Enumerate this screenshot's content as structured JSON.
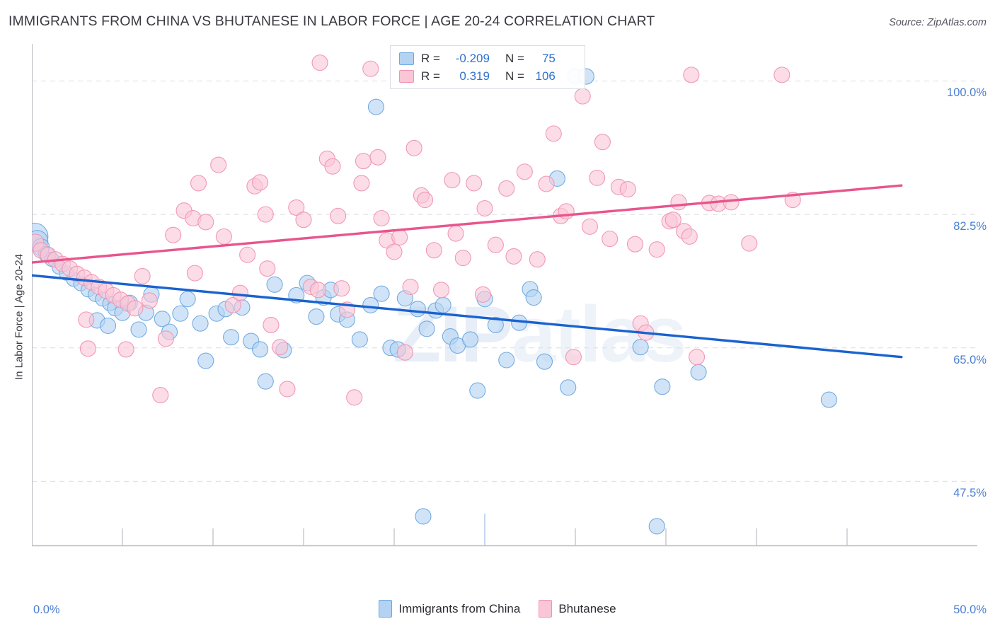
{
  "header": {
    "title": "IMMIGRANTS FROM CHINA VS BHUTANESE IN LABOR FORCE | AGE 20-24 CORRELATION CHART",
    "source": "Source: ZipAtlas.com"
  },
  "watermark": {
    "text_1": "ZIP",
    "text_2": "atlas"
  },
  "stats": {
    "rows": [
      {
        "series": "Immigrants from China",
        "swatch": "blue",
        "r_key": "R =",
        "r_value": "-0.209",
        "n_key": "N =",
        "n_value": "75"
      },
      {
        "series": "Bhutanese",
        "swatch": "pink",
        "r_key": "R =",
        "r_value": "0.319",
        "n_key": "N =",
        "n_value": "106"
      }
    ]
  },
  "legend": {
    "items": [
      {
        "label": "Immigrants from China",
        "color": "#b4d3f2"
      },
      {
        "label": "Bhutanese",
        "color": "#fac6d6"
      }
    ]
  },
  "colors": {
    "blue_fill": "#b4d3f2",
    "blue_stroke": "#6ea8e0",
    "blue_line": "#1a62cf",
    "pink_fill": "#fac6d6",
    "pink_stroke": "#f093b2",
    "pink_line": "#e8558c",
    "tick_text": "#4a7fd4",
    "grid": "#dcdce2"
  },
  "chart_data": {
    "type": "scatter",
    "title": "IMMIGRANTS FROM CHINA VS BHUTANESE IN LABOR FORCE | AGE 20-24 CORRELATION CHART",
    "xlabel": "",
    "ylabel": "In Labor Force | Age 20-24",
    "xlim": [
      0,
      50
    ],
    "ylim": [
      39.0,
      103.2
    ],
    "grid": true,
    "legend_position": "bottom-center",
    "x_ticks": [
      {
        "value": 0,
        "label": "0.0%"
      },
      {
        "value": 50,
        "label": "50.0%"
      }
    ],
    "y_ticks": [
      {
        "value": 100.0,
        "label": "100.0%"
      },
      {
        "value": 82.5,
        "label": "82.5%"
      },
      {
        "value": 65.0,
        "label": "65.0%"
      },
      {
        "value": 47.5,
        "label": "47.5%"
      }
    ],
    "series": [
      {
        "name": "Immigrants from China",
        "color": "#b4d3f2",
        "stroke": "#6ea8e0",
        "r": -0.209,
        "n": 75,
        "trendline": {
          "color": "#1a62cf",
          "x0": 0.0,
          "y0": 74.5,
          "x1": 48.0,
          "y1": 63.8
        },
        "points": [
          {
            "x": 0.15,
            "y": 79.6,
            "r": 19
          },
          {
            "x": 0.3,
            "y": 79.0,
            "r": 15
          },
          {
            "x": 0.5,
            "y": 78.2,
            "r": 12
          },
          {
            "x": 0.8,
            "y": 77.3,
            "r": 11
          },
          {
            "x": 1.1,
            "y": 76.6,
            "r": 10
          },
          {
            "x": 1.5,
            "y": 75.6,
            "r": 10
          },
          {
            "x": 1.9,
            "y": 74.8,
            "r": 10
          },
          {
            "x": 2.3,
            "y": 74.0,
            "r": 10
          },
          {
            "x": 2.7,
            "y": 73.4,
            "r": 10
          },
          {
            "x": 3.1,
            "y": 72.6,
            "r": 10
          },
          {
            "x": 3.5,
            "y": 72.0,
            "r": 10
          },
          {
            "x": 3.9,
            "y": 71.4,
            "r": 10
          },
          {
            "x": 4.3,
            "y": 70.8,
            "r": 10
          },
          {
            "x": 4.6,
            "y": 70.2,
            "r": 11
          },
          {
            "x": 5.0,
            "y": 69.6,
            "r": 11
          },
          {
            "x": 3.6,
            "y": 68.6,
            "r": 11
          },
          {
            "x": 4.2,
            "y": 67.9,
            "r": 11
          },
          {
            "x": 5.4,
            "y": 70.9,
            "r": 11
          },
          {
            "x": 5.9,
            "y": 67.4,
            "r": 11
          },
          {
            "x": 6.3,
            "y": 69.6,
            "r": 11
          },
          {
            "x": 6.6,
            "y": 72.0,
            "r": 11
          },
          {
            "x": 7.2,
            "y": 68.8,
            "r": 11
          },
          {
            "x": 7.6,
            "y": 67.1,
            "r": 11
          },
          {
            "x": 8.2,
            "y": 69.5,
            "r": 11
          },
          {
            "x": 8.6,
            "y": 71.4,
            "r": 11
          },
          {
            "x": 9.3,
            "y": 68.2,
            "r": 11
          },
          {
            "x": 9.6,
            "y": 63.3,
            "r": 11
          },
          {
            "x": 10.2,
            "y": 69.5,
            "r": 11
          },
          {
            "x": 10.7,
            "y": 70.1,
            "r": 11
          },
          {
            "x": 11.0,
            "y": 66.4,
            "r": 11
          },
          {
            "x": 11.6,
            "y": 70.3,
            "r": 11
          },
          {
            "x": 12.1,
            "y": 65.9,
            "r": 11
          },
          {
            "x": 12.6,
            "y": 64.8,
            "r": 11
          },
          {
            "x": 12.9,
            "y": 60.6,
            "r": 11
          },
          {
            "x": 13.4,
            "y": 73.3,
            "r": 11
          },
          {
            "x": 13.9,
            "y": 64.7,
            "r": 11
          },
          {
            "x": 14.6,
            "y": 71.9,
            "r": 11
          },
          {
            "x": 15.2,
            "y": 73.5,
            "r": 11
          },
          {
            "x": 15.7,
            "y": 69.1,
            "r": 11
          },
          {
            "x": 16.1,
            "y": 71.6,
            "r": 11
          },
          {
            "x": 16.5,
            "y": 72.6,
            "r": 11
          },
          {
            "x": 16.9,
            "y": 69.4,
            "r": 11
          },
          {
            "x": 17.4,
            "y": 68.7,
            "r": 11
          },
          {
            "x": 18.1,
            "y": 66.1,
            "r": 11
          },
          {
            "x": 18.7,
            "y": 70.6,
            "r": 11
          },
          {
            "x": 19.3,
            "y": 72.1,
            "r": 11
          },
          {
            "x": 19.8,
            "y": 65.0,
            "r": 11
          },
          {
            "x": 20.2,
            "y": 64.8,
            "r": 11
          },
          {
            "x": 20.6,
            "y": 71.5,
            "r": 11
          },
          {
            "x": 19.0,
            "y": 96.6,
            "r": 11
          },
          {
            "x": 21.3,
            "y": 70.1,
            "r": 11
          },
          {
            "x": 21.8,
            "y": 67.5,
            "r": 11
          },
          {
            "x": 22.3,
            "y": 69.9,
            "r": 11
          },
          {
            "x": 22.7,
            "y": 70.6,
            "r": 11
          },
          {
            "x": 23.1,
            "y": 66.5,
            "r": 11
          },
          {
            "x": 23.5,
            "y": 65.3,
            "r": 11
          },
          {
            "x": 21.6,
            "y": 42.9,
            "r": 11
          },
          {
            "x": 24.2,
            "y": 66.1,
            "r": 11
          },
          {
            "x": 25.0,
            "y": 71.4,
            "r": 11
          },
          {
            "x": 25.6,
            "y": 68.0,
            "r": 11
          },
          {
            "x": 26.2,
            "y": 63.4,
            "r": 11
          },
          {
            "x": 24.6,
            "y": 59.4,
            "r": 11
          },
          {
            "x": 26.9,
            "y": 68.3,
            "r": 11
          },
          {
            "x": 27.5,
            "y": 72.7,
            "r": 11
          },
          {
            "x": 27.7,
            "y": 71.6,
            "r": 11
          },
          {
            "x": 28.3,
            "y": 63.2,
            "r": 11
          },
          {
            "x": 29.0,
            "y": 87.2,
            "r": 11
          },
          {
            "x": 29.6,
            "y": 59.8,
            "r": 11
          },
          {
            "x": 30.0,
            "y": 100.6,
            "r": 11
          },
          {
            "x": 30.6,
            "y": 100.6,
            "r": 11
          },
          {
            "x": 33.6,
            "y": 65.1,
            "r": 11
          },
          {
            "x": 34.8,
            "y": 59.9,
            "r": 11
          },
          {
            "x": 34.5,
            "y": 41.6,
            "r": 11
          },
          {
            "x": 36.8,
            "y": 61.8,
            "r": 11
          },
          {
            "x": 44.0,
            "y": 58.2,
            "r": 11
          }
        ]
      },
      {
        "name": "Bhutanese",
        "color": "#fac6d6",
        "stroke": "#f093b2",
        "r": 0.319,
        "n": 106,
        "trendline": {
          "color": "#e8558c",
          "x0": 0.0,
          "y0": 76.2,
          "x1": 48.0,
          "y1": 86.3
        },
        "points": [
          {
            "x": 0.2,
            "y": 78.8,
            "r": 12
          },
          {
            "x": 0.5,
            "y": 77.8,
            "r": 11
          },
          {
            "x": 0.9,
            "y": 77.2,
            "r": 11
          },
          {
            "x": 1.3,
            "y": 76.6,
            "r": 11
          },
          {
            "x": 1.7,
            "y": 76.0,
            "r": 11
          },
          {
            "x": 2.1,
            "y": 75.4,
            "r": 11
          },
          {
            "x": 2.5,
            "y": 74.7,
            "r": 11
          },
          {
            "x": 2.9,
            "y": 74.2,
            "r": 11
          },
          {
            "x": 3.3,
            "y": 73.6,
            "r": 11
          },
          {
            "x": 3.7,
            "y": 73.0,
            "r": 11
          },
          {
            "x": 4.1,
            "y": 72.5,
            "r": 11
          },
          {
            "x": 4.5,
            "y": 71.9,
            "r": 11
          },
          {
            "x": 4.9,
            "y": 71.3,
            "r": 11
          },
          {
            "x": 5.3,
            "y": 70.8,
            "r": 11
          },
          {
            "x": 5.7,
            "y": 70.2,
            "r": 11
          },
          {
            "x": 3.0,
            "y": 68.7,
            "r": 11
          },
          {
            "x": 3.1,
            "y": 64.9,
            "r": 11
          },
          {
            "x": 5.2,
            "y": 64.8,
            "r": 11
          },
          {
            "x": 6.1,
            "y": 74.4,
            "r": 11
          },
          {
            "x": 6.5,
            "y": 71.2,
            "r": 11
          },
          {
            "x": 7.1,
            "y": 58.8,
            "r": 11
          },
          {
            "x": 7.4,
            "y": 66.2,
            "r": 11
          },
          {
            "x": 7.8,
            "y": 79.8,
            "r": 11
          },
          {
            "x": 8.4,
            "y": 83.0,
            "r": 11
          },
          {
            "x": 8.9,
            "y": 82.0,
            "r": 11
          },
          {
            "x": 9.2,
            "y": 86.6,
            "r": 11
          },
          {
            "x": 9.6,
            "y": 81.5,
            "r": 11
          },
          {
            "x": 10.3,
            "y": 89.0,
            "r": 11
          },
          {
            "x": 10.6,
            "y": 79.6,
            "r": 11
          },
          {
            "x": 11.1,
            "y": 70.6,
            "r": 11
          },
          {
            "x": 11.5,
            "y": 72.2,
            "r": 11
          },
          {
            "x": 11.9,
            "y": 77.2,
            "r": 11
          },
          {
            "x": 12.3,
            "y": 86.2,
            "r": 11
          },
          {
            "x": 12.6,
            "y": 86.7,
            "r": 11
          },
          {
            "x": 12.9,
            "y": 82.5,
            "r": 11
          },
          {
            "x": 13.2,
            "y": 68.0,
            "r": 11
          },
          {
            "x": 13.7,
            "y": 65.1,
            "r": 11
          },
          {
            "x": 14.1,
            "y": 59.6,
            "r": 11
          },
          {
            "x": 14.6,
            "y": 83.4,
            "r": 11
          },
          {
            "x": 15.0,
            "y": 81.8,
            "r": 11
          },
          {
            "x": 15.4,
            "y": 73.0,
            "r": 11
          },
          {
            "x": 15.8,
            "y": 72.6,
            "r": 11
          },
          {
            "x": 15.9,
            "y": 102.4,
            "r": 11
          },
          {
            "x": 16.3,
            "y": 89.8,
            "r": 11
          },
          {
            "x": 16.6,
            "y": 88.8,
            "r": 11
          },
          {
            "x": 16.9,
            "y": 82.3,
            "r": 11
          },
          {
            "x": 17.1,
            "y": 72.8,
            "r": 11
          },
          {
            "x": 17.4,
            "y": 70.0,
            "r": 11
          },
          {
            "x": 17.8,
            "y": 58.5,
            "r": 11
          },
          {
            "x": 18.2,
            "y": 86.6,
            "r": 11
          },
          {
            "x": 18.3,
            "y": 89.5,
            "r": 11
          },
          {
            "x": 18.7,
            "y": 101.6,
            "r": 11
          },
          {
            "x": 19.1,
            "y": 90.0,
            "r": 11
          },
          {
            "x": 19.3,
            "y": 82.0,
            "r": 11
          },
          {
            "x": 19.6,
            "y": 79.1,
            "r": 11
          },
          {
            "x": 20.0,
            "y": 77.6,
            "r": 11
          },
          {
            "x": 20.3,
            "y": 79.5,
            "r": 11
          },
          {
            "x": 20.6,
            "y": 64.4,
            "r": 11
          },
          {
            "x": 21.1,
            "y": 91.2,
            "r": 11
          },
          {
            "x": 21.5,
            "y": 85.0,
            "r": 11
          },
          {
            "x": 21.7,
            "y": 84.4,
            "r": 11
          },
          {
            "x": 22.2,
            "y": 77.8,
            "r": 11
          },
          {
            "x": 22.6,
            "y": 72.6,
            "r": 11
          },
          {
            "x": 23.2,
            "y": 87.0,
            "r": 11
          },
          {
            "x": 23.4,
            "y": 80.0,
            "r": 11
          },
          {
            "x": 23.8,
            "y": 76.8,
            "r": 11
          },
          {
            "x": 24.4,
            "y": 86.6,
            "r": 11
          },
          {
            "x": 25.0,
            "y": 83.3,
            "r": 11
          },
          {
            "x": 25.6,
            "y": 78.5,
            "r": 11
          },
          {
            "x": 26.2,
            "y": 85.9,
            "r": 11
          },
          {
            "x": 26.6,
            "y": 77.0,
            "r": 11
          },
          {
            "x": 27.2,
            "y": 88.1,
            "r": 11
          },
          {
            "x": 27.9,
            "y": 76.6,
            "r": 11
          },
          {
            "x": 28.4,
            "y": 86.5,
            "r": 11
          },
          {
            "x": 28.8,
            "y": 93.1,
            "r": 11
          },
          {
            "x": 29.2,
            "y": 82.3,
            "r": 11
          },
          {
            "x": 29.5,
            "y": 82.9,
            "r": 11
          },
          {
            "x": 29.9,
            "y": 63.8,
            "r": 11
          },
          {
            "x": 30.4,
            "y": 98.0,
            "r": 11
          },
          {
            "x": 30.8,
            "y": 80.9,
            "r": 11
          },
          {
            "x": 31.2,
            "y": 87.3,
            "r": 11
          },
          {
            "x": 31.5,
            "y": 92.0,
            "r": 11
          },
          {
            "x": 31.9,
            "y": 79.3,
            "r": 11
          },
          {
            "x": 32.4,
            "y": 86.1,
            "r": 11
          },
          {
            "x": 32.9,
            "y": 85.8,
            "r": 11
          },
          {
            "x": 33.3,
            "y": 78.6,
            "r": 11
          },
          {
            "x": 33.6,
            "y": 68.2,
            "r": 11
          },
          {
            "x": 33.9,
            "y": 67.0,
            "r": 11
          },
          {
            "x": 34.5,
            "y": 77.9,
            "r": 11
          },
          {
            "x": 35.2,
            "y": 81.6,
            "r": 11
          },
          {
            "x": 35.4,
            "y": 81.8,
            "r": 11
          },
          {
            "x": 35.7,
            "y": 84.1,
            "r": 11
          },
          {
            "x": 36.0,
            "y": 80.3,
            "r": 11
          },
          {
            "x": 36.3,
            "y": 79.6,
            "r": 11
          },
          {
            "x": 36.4,
            "y": 100.8,
            "r": 11
          },
          {
            "x": 36.7,
            "y": 63.8,
            "r": 11
          },
          {
            "x": 37.4,
            "y": 84.0,
            "r": 11
          },
          {
            "x": 37.9,
            "y": 83.9,
            "r": 11
          },
          {
            "x": 38.6,
            "y": 84.1,
            "r": 11
          },
          {
            "x": 39.6,
            "y": 78.7,
            "r": 11
          },
          {
            "x": 41.4,
            "y": 100.8,
            "r": 11
          },
          {
            "x": 42.0,
            "y": 84.4,
            "r": 11
          },
          {
            "x": 9.0,
            "y": 74.8,
            "r": 11
          },
          {
            "x": 13.0,
            "y": 75.4,
            "r": 11
          },
          {
            "x": 20.9,
            "y": 73.0,
            "r": 11
          },
          {
            "x": 24.9,
            "y": 72.0,
            "r": 11
          }
        ]
      }
    ]
  }
}
